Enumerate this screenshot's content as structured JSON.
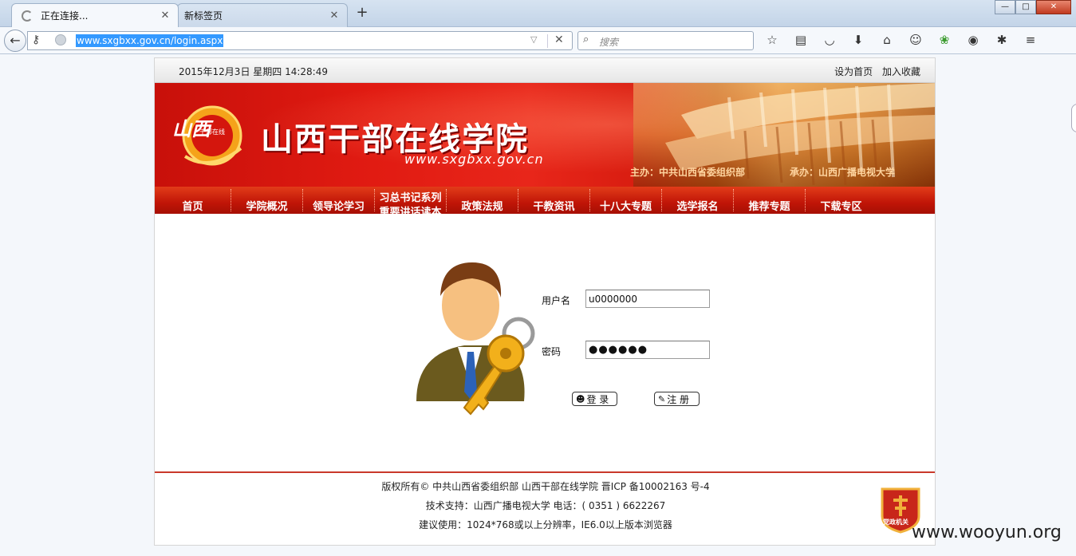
{
  "browser": {
    "tabs": [
      {
        "title": "正在连接...",
        "close": "✕"
      },
      {
        "title": "新标签页",
        "close": "✕"
      }
    ],
    "new_tab": "+",
    "window_controls": [
      "—",
      "□",
      "✕"
    ],
    "back": "←",
    "url": "www.sxgbxx.gov.cn/login.aspx",
    "url_dropdown": "▽",
    "url_clear": "✕",
    "search_placeholder": "搜索",
    "toolbar_icons": [
      "star-icon",
      "reading-list-icon",
      "pocket-icon",
      "download-icon",
      "home-icon",
      "chat-icon",
      "addon-icon",
      "feeds-icon",
      "extension-icon",
      "menu-icon"
    ]
  },
  "site": {
    "date": "2015年12月3日 星期四 14:28:49",
    "top_links": [
      "设为首页",
      "加入收藏"
    ],
    "title": "山西干部在线学院",
    "url_text": "www.sxgbxx.gov.cn",
    "logo_text": "山西",
    "logo_sub": "干部在线",
    "sponsor": "主办：中共山西省委组织部",
    "organizer": "承办：山西广播电视大学",
    "nav": [
      {
        "label": "首页"
      },
      {
        "label": "学院概况"
      },
      {
        "label": "领导论学习"
      },
      {
        "label": "习总书记系列重要讲话读本"
      },
      {
        "label": "政策法规"
      },
      {
        "label": "干教资讯"
      },
      {
        "label": "十八大专题"
      },
      {
        "label": "选学报名"
      },
      {
        "label": "推荐专题"
      },
      {
        "label": "下载专区"
      }
    ]
  },
  "login": {
    "username_label": "用户名",
    "username_value": "u0000000",
    "password_label": "密码",
    "password_value": "●●●●●●",
    "login_button": "登 录",
    "register_button": "注 册"
  },
  "footer": {
    "line1": "版权所有©  中共山西省委组织部 山西干部在线学院 晋ICP 备10002163 号-4",
    "line2": "技术支持：山西广播电视大学 电话：( 0351 ) 6622267",
    "line3": "建议使用：1024*768或以上分辨率，IE6.0以上版本浏览器",
    "badge_text": "党政机关"
  },
  "watermark": "www.wooyun.org",
  "colors": {
    "banner_red": "#e11b12",
    "nav_red": "#c01507",
    "footer_line": "#c9392a",
    "url_selection": "#3399ff"
  }
}
